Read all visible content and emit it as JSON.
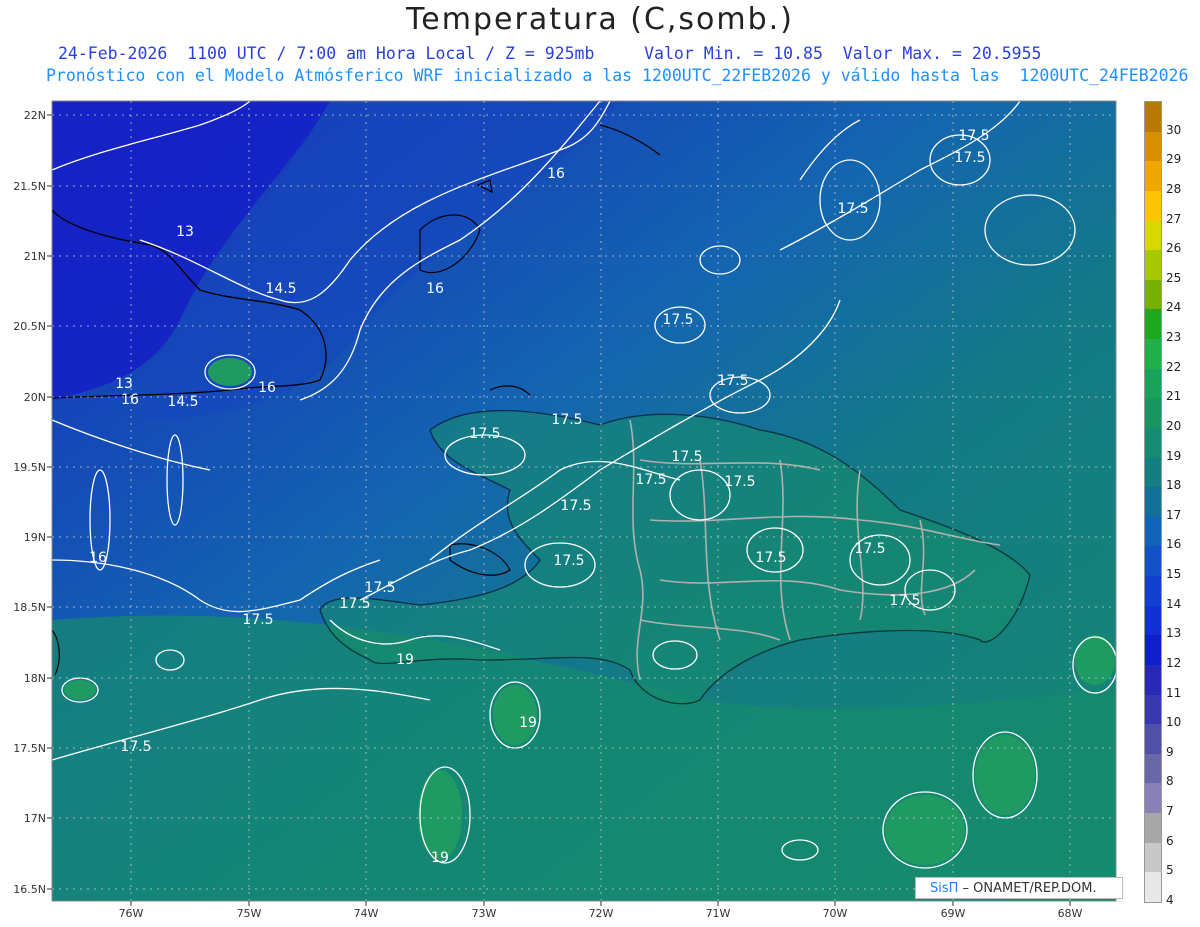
{
  "header": {
    "title": "Temperatura (C,somb.)",
    "line1": "24-Feb-2026  1100 UTC / 7:00 am Hora Local / Z = 925mb     Valor Min. = 10.85  Valor Max. = 20.5955",
    "line2": "Pronóstico con el Modelo Atmósferico WRF inicializado a las 1200UTC_22FEB2026 y válido hasta las  1200UTC_24FEB2026"
  },
  "map": {
    "lat_labels": [
      "22N",
      "21.5N",
      "21N",
      "20.5N",
      "20N",
      "19.5N",
      "19N",
      "18.5N",
      "18N",
      "17.5N",
      "17N",
      "16.5N"
    ],
    "lon_labels": [
      "76W",
      "75W",
      "74W",
      "73W",
      "72W",
      "71W",
      "70W",
      "69W",
      "68W"
    ],
    "contour_labels": [
      {
        "text": "13"
      },
      {
        "text": "13"
      },
      {
        "text": "14.5"
      },
      {
        "text": "14.5"
      },
      {
        "text": "16"
      },
      {
        "text": "16"
      },
      {
        "text": "16"
      },
      {
        "text": "16"
      },
      {
        "text": "16"
      },
      {
        "text": "17.5"
      },
      {
        "text": "17.5"
      },
      {
        "text": "17.5"
      },
      {
        "text": "17.5"
      },
      {
        "text": "17.5"
      },
      {
        "text": "17.5"
      },
      {
        "text": "17.5"
      },
      {
        "text": "17.5"
      },
      {
        "text": "17.5"
      },
      {
        "text": "17.5"
      },
      {
        "text": "17.5"
      },
      {
        "text": "17.5"
      },
      {
        "text": "17.5"
      },
      {
        "text": "17.5"
      },
      {
        "text": "17.5"
      },
      {
        "text": "17.5"
      },
      {
        "text": "17.5"
      },
      {
        "text": "17.5"
      },
      {
        "text": "19"
      },
      {
        "text": "19"
      },
      {
        "text": "19"
      }
    ]
  },
  "colorbar": {
    "labels": [
      "30",
      "29",
      "28",
      "27",
      "26",
      "25",
      "24",
      "23",
      "22",
      "21",
      "20",
      "19",
      "18",
      "17",
      "16",
      "15",
      "14",
      "13",
      "12",
      "11",
      "10",
      "9",
      "8",
      "7",
      "6",
      "5",
      "4"
    ],
    "colors": [
      "#b87a00",
      "#d69000",
      "#f0a800",
      "#ffc400",
      "#d8d800",
      "#a8c800",
      "#78b000",
      "#1fa81f",
      "#1fb04a",
      "#19a35a",
      "#1a9460",
      "#178a72",
      "#157e80",
      "#136f98",
      "#1262b8",
      "#1252c8",
      "#1140d0",
      "#1030d0",
      "#1020c8",
      "#2828b8",
      "#3838b0",
      "#5050a8",
      "#6868a8",
      "#8a80b8",
      "#a8a8a8",
      "#c8c8c8",
      "#e8e8e8"
    ]
  },
  "credit": {
    "sis": "SisΠ",
    "rest": " – ONAMET/REP.DOM."
  }
}
